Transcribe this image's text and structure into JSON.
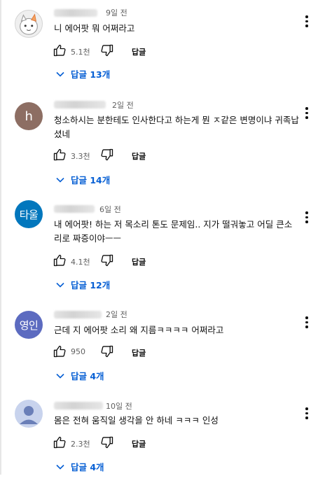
{
  "comments": [
    {
      "avatar": {
        "type": "cartoon",
        "text": "",
        "color": "#efefef"
      },
      "time": "9일 전",
      "text": "니 에어팟 뭐 어쩌라고",
      "likes": "5.1천",
      "reply_label": "답글",
      "replies_label": "답글 13개"
    },
    {
      "avatar": {
        "type": "letter",
        "text": "h",
        "color": "#8d6e63"
      },
      "time": "2일 전",
      "text": "청소하시는 분한테도 인사한다고 하는게 뭔 ㅈ같은 변명이냐 귀족납셨네",
      "likes": "3.3천",
      "reply_label": "답글",
      "replies_label": "답글 14개"
    },
    {
      "avatar": {
        "type": "letter",
        "text": "타울",
        "color": "#0277bd"
      },
      "time": "6일 전",
      "text": "내 에어팟! 하는 저 목소리 톤도 문제임.. 지가 떨궈놓고 어딜 큰소리로 짜증이야ㅡㅡ",
      "likes": "4.1천",
      "reply_label": "답글",
      "replies_label": "답글 12개"
    },
    {
      "avatar": {
        "type": "letter",
        "text": "영인",
        "color": "#5c6bc0"
      },
      "time": "2일 전",
      "text": "근데 지 에어팟 소리 왜 지름ㅋㅋㅋㅋ 어쩌라고",
      "likes": "950",
      "reply_label": "답글",
      "replies_label": "답글 4개"
    },
    {
      "avatar": {
        "type": "default",
        "text": "",
        "color": "#c8d3ed"
      },
      "time": "10일 전",
      "text": "몸은 전혀 움직일 생각을 안 하네 ㅋㅋㅋ 인성",
      "likes": "2.3천",
      "reply_label": "답글",
      "replies_label": "답글 4개"
    }
  ],
  "colors": {
    "link_blue": "#065fd4",
    "meta_gray": "#606060",
    "text": "#0f0f0f"
  }
}
